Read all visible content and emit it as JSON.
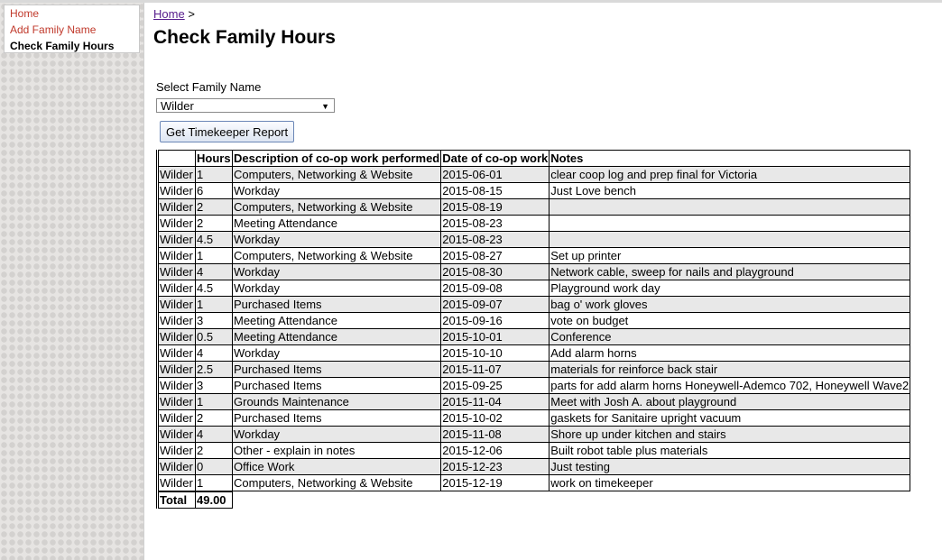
{
  "nav": {
    "home": "Home",
    "add_family": "Add Family Name",
    "check_hours": "Check Family Hours"
  },
  "breadcrumb": {
    "home": "Home",
    "sep": ">"
  },
  "page_title": "Check Family Hours",
  "form": {
    "label": "Select Family Name",
    "selected": "Wilder",
    "button": "Get Timekeeper Report"
  },
  "table": {
    "headers": [
      "",
      "Hours",
      "Description of co-op work performed",
      "Date of co-op work",
      "Notes"
    ],
    "rows": [
      [
        "Wilder",
        "1",
        "Computers, Networking & Website",
        "2015-06-01",
        "clear coop log and prep final for Victoria"
      ],
      [
        "Wilder",
        "6",
        "Workday",
        "2015-08-15",
        "Just Love bench"
      ],
      [
        "Wilder",
        "2",
        "Computers, Networking & Website",
        "2015-08-19",
        ""
      ],
      [
        "Wilder",
        "2",
        "Meeting Attendance",
        "2015-08-23",
        ""
      ],
      [
        "Wilder",
        "4.5",
        "Workday",
        "2015-08-23",
        ""
      ],
      [
        "Wilder",
        "1",
        "Computers, Networking & Website",
        "2015-08-27",
        "Set up printer"
      ],
      [
        "Wilder",
        "4",
        "Workday",
        "2015-08-30",
        "Network cable, sweep for nails and playground"
      ],
      [
        "Wilder",
        "4.5",
        "Workday",
        "2015-09-08",
        "Playground work day"
      ],
      [
        "Wilder",
        "1",
        "Purchased Items",
        "2015-09-07",
        "bag o' work gloves"
      ],
      [
        "Wilder",
        "3",
        "Meeting Attendance",
        "2015-09-16",
        "vote on budget"
      ],
      [
        "Wilder",
        "0.5",
        "Meeting Attendance",
        "2015-10-01",
        "Conference"
      ],
      [
        "Wilder",
        "4",
        "Workday",
        "2015-10-10",
        "Add alarm horns"
      ],
      [
        "Wilder",
        "2.5",
        "Purchased Items",
        "2015-11-07",
        "materials for reinforce back stair"
      ],
      [
        "Wilder",
        "3",
        "Purchased Items",
        "2015-09-25",
        "parts for add alarm horns Honeywell-Ademco 702, Honeywell Wave2"
      ],
      [
        "Wilder",
        "1",
        "Grounds Maintenance",
        "2015-11-04",
        "Meet with Josh A. about playground"
      ],
      [
        "Wilder",
        "2",
        "Purchased Items",
        "2015-10-02",
        "gaskets for Sanitaire upright vacuum"
      ],
      [
        "Wilder",
        "4",
        "Workday",
        "2015-11-08",
        "Shore up under kitchen and stairs"
      ],
      [
        "Wilder",
        "2",
        "Other - explain in notes",
        "2015-12-06",
        "Built robot table plus materials"
      ],
      [
        "Wilder",
        "0",
        "Office Work",
        "2015-12-23",
        "Just testing"
      ],
      [
        "Wilder",
        "1",
        "Computers, Networking & Website",
        "2015-12-19",
        "work on timekeeper"
      ]
    ],
    "total_label": "Total",
    "total_value": "49.00"
  }
}
